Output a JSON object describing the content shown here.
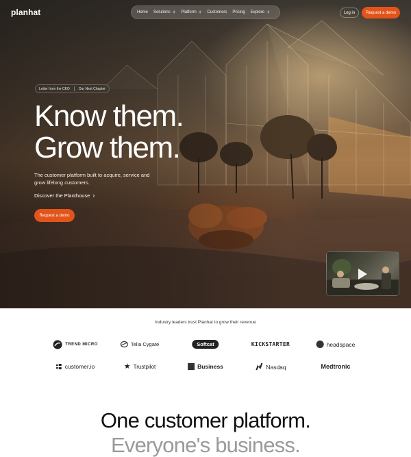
{
  "header": {
    "logo": "planhat",
    "nav": [
      {
        "label": "Home",
        "has_plus": false
      },
      {
        "label": "Solutions",
        "has_plus": true
      },
      {
        "label": "Platform",
        "has_plus": true
      },
      {
        "label": "Customers",
        "has_plus": false
      },
      {
        "label": "Pricing",
        "has_plus": false
      },
      {
        "label": "Explore",
        "has_plus": true
      }
    ],
    "login": "Log in",
    "cta": "Request a demo"
  },
  "hero": {
    "pill_left": "Letter from the CEO",
    "pill_right": "Our Next Chapter",
    "headline_line1": "Know them.",
    "headline_line2": "Grow them.",
    "subtext": "The customer platform built to acquire, service and grow lifelong customers.",
    "discover": "Discover the Planthouse",
    "cta": "Request a demo"
  },
  "trust": {
    "heading": "Industry leaders trust Planhat to grow their revenue",
    "logos": [
      {
        "name": "TREND MICRO",
        "icon": "trend-micro-icon"
      },
      {
        "name": "Telia Cygate",
        "icon": "telia-icon"
      },
      {
        "name": "Softcat",
        "icon": "softcat-badge"
      },
      {
        "name": "KICKSTARTER",
        "icon": "none"
      },
      {
        "name": "headspace",
        "icon": "headspace-dot"
      },
      {
        "name": "customer.io",
        "icon": "customerio-icon"
      },
      {
        "name": "Trustpilot",
        "icon": "star-icon"
      },
      {
        "name": "Business",
        "icon": "business-square-icon"
      },
      {
        "name": "Nasdaq",
        "icon": "nasdaq-icon"
      },
      {
        "name": "Medtronic",
        "icon": "none"
      }
    ]
  },
  "section": {
    "title_line1": "One customer platform.",
    "title_line2": "Everyone's business."
  },
  "colors": {
    "accent": "#e2541a",
    "muted_heading": "#9a9a9a"
  }
}
